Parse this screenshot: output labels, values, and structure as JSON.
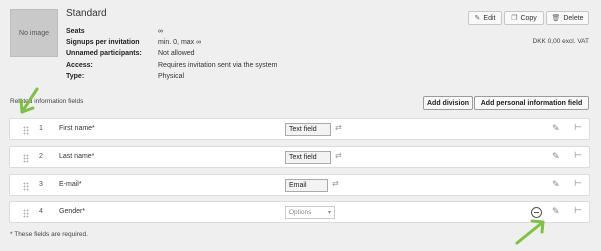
{
  "ticket": {
    "image_placeholder": "No image",
    "title": "Standard",
    "info": [
      {
        "label": "Seats",
        "value": "∞"
      },
      {
        "label": "Signups per invitation",
        "value": "min. 0, max ∞"
      },
      {
        "label": "Unnamed participants:",
        "value": "Not allowed"
      },
      {
        "label": "Access:",
        "value": "Requires invitation sent via the system"
      },
      {
        "label": "Type:",
        "value": "Physical"
      }
    ],
    "price": "DKK 0,00 excl. VAT"
  },
  "toolbar": {
    "edit_label": "Edit",
    "copy_label": "Copy",
    "delete_label": "Delete"
  },
  "fields_section": {
    "label": "Related information fields",
    "add_division_label": "Add division",
    "add_personal_label": "Add personal information field"
  },
  "fields": [
    {
      "num": "1",
      "name": "First name*",
      "type": "Text field"
    },
    {
      "num": "2",
      "name": "Last name*",
      "type": "Text field"
    },
    {
      "num": "3",
      "name": "E-mail*",
      "type": "Email"
    },
    {
      "num": "4",
      "name": "Gender*",
      "type": "Options"
    }
  ],
  "footnote": "* These fields are required.",
  "colors": {
    "annotation_arrow": "#7dc242",
    "background": "#efefef"
  }
}
